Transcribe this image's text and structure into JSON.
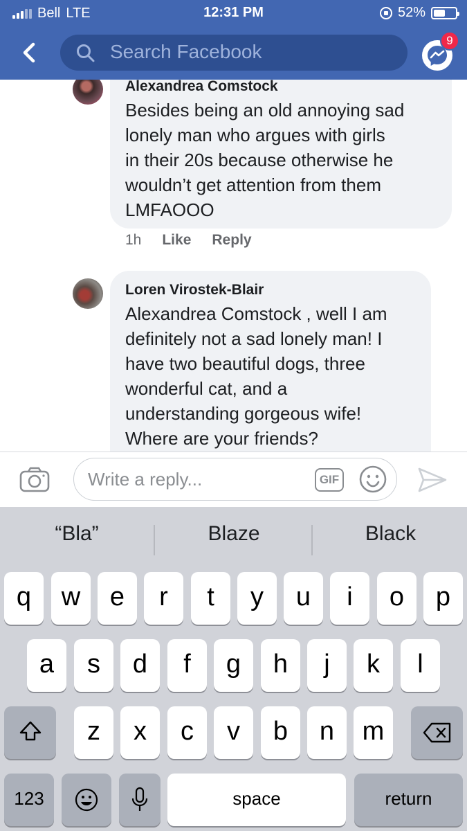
{
  "status_bar": {
    "carrier": "Bell",
    "network": "LTE",
    "time": "12:31 PM",
    "battery": "52%",
    "battery_level": 0.52
  },
  "header": {
    "search_placeholder": "Search Facebook",
    "messenger_badge": "9",
    "icons": [
      "back-arrow-icon",
      "search-icon",
      "messenger-icon"
    ],
    "colors": {
      "header": "#4267b2",
      "badge": "#f02849"
    }
  },
  "comments": [
    {
      "author": "Alexandrea Comstock",
      "text": "Besides being an old annoying sad\nlonely man who argues with girls\nin their 20s because otherwise he\nwouldn’t get attention from them\nLMFAOOO",
      "time": "1h",
      "like_label": "Like",
      "reply_label": "Reply"
    },
    {
      "author": "Loren Virostek-Blair",
      "text": "Alexandrea Comstock , well I am\ndefinitely not a sad lonely man! I\nhave two beautiful dogs, three\nwonderful cat, and a\nunderstanding gorgeous wife!\nWhere are your friends?"
    }
  ],
  "reply_bar": {
    "placeholder": "Write a reply...",
    "gif_label": "GIF",
    "icons": [
      "camera-icon",
      "gif-icon",
      "emoji-icon",
      "send-icon"
    ]
  },
  "keyboard": {
    "suggestions": [
      "“Bla”",
      "Blaze",
      "Black"
    ],
    "row1": [
      "q",
      "w",
      "e",
      "r",
      "t",
      "y",
      "u",
      "i",
      "o",
      "p"
    ],
    "row2": [
      "a",
      "s",
      "d",
      "f",
      "g",
      "h",
      "j",
      "k",
      "l"
    ],
    "row3": [
      "z",
      "x",
      "c",
      "v",
      "b",
      "n",
      "m"
    ],
    "numbers_label": "123",
    "space_label": "space",
    "return_label": "return"
  }
}
